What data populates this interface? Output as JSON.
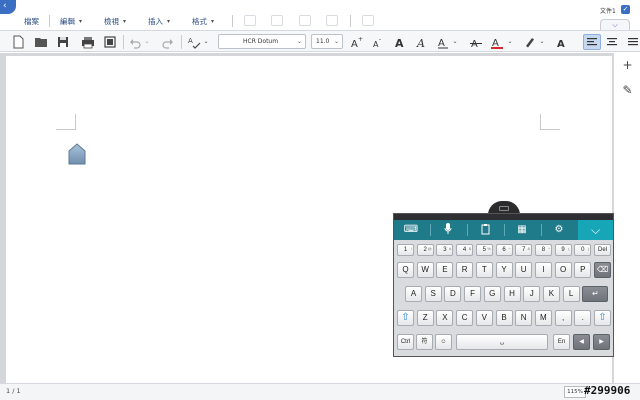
{
  "app": {
    "corner_glyph": "‹",
    "doc_name": "文件1",
    "check_glyph": "✓",
    "fold_glyph": "⌵"
  },
  "menus": [
    {
      "label": "檔案"
    },
    {
      "label": "編輯"
    },
    {
      "label": "檢視"
    },
    {
      "label": "插入"
    },
    {
      "label": "格式"
    }
  ],
  "menu_caret": "▾",
  "toolbar": {
    "font_name": "HCR Dotum",
    "font_size": "11.0",
    "dropdown_glyph": "⌄",
    "icons": {
      "new": "new-document-icon",
      "open": "folder-open-icon",
      "save": "save-icon",
      "print": "print-icon",
      "layout": "page-layout-icon",
      "undo": "undo-icon",
      "redo": "redo-icon",
      "spell": "spellcheck-icon",
      "grow": "grow-font-icon",
      "shrink": "shrink-font-icon",
      "bold": "bold-icon",
      "italic": "italic-icon",
      "underline": "underline-icon",
      "strike": "strikethrough-icon",
      "color": "font-color-icon",
      "highlight": "highlight-icon",
      "shade": "text-shade-icon",
      "align_left": "align-left-icon",
      "align_center": "align-center-icon",
      "align_justify": "align-justify-icon"
    },
    "accent_color": "#c6d7f0",
    "font_color": "#d62b2b"
  },
  "status": {
    "page": "1 / 1",
    "zoom": "115%",
    "watermark": "#299906"
  },
  "side_panel": {
    "add_glyph": "+",
    "edit_glyph": "✎"
  },
  "keyboard": {
    "toolbar_icons": [
      "keyboard-icon",
      "microphone-icon",
      "clipboard-icon",
      "emoji-table-icon",
      "settings-icon",
      "chevron-down-icon"
    ],
    "toolbar_glyphs": [
      "⌨",
      "🎤",
      "📋",
      "▦",
      "⚙",
      "⌵"
    ],
    "number_row": [
      "1",
      "2",
      "3",
      "4",
      "5",
      "6",
      "7",
      "8",
      "9",
      "0",
      "Del"
    ],
    "number_sups": [
      "!",
      "@",
      "#",
      "$",
      "%",
      "^",
      "&",
      "*",
      "(",
      ")",
      ""
    ],
    "row1": [
      "Q",
      "W",
      "E",
      "R",
      "T",
      "Y",
      "U",
      "I",
      "O",
      "P",
      "⌫"
    ],
    "row2": [
      "A",
      "S",
      "D",
      "F",
      "G",
      "H",
      "J",
      "K",
      "L",
      "↵"
    ],
    "row3": [
      "⇧",
      "Z",
      "X",
      "C",
      "V",
      "B",
      "N",
      "M",
      ",",
      ".",
      "⇧"
    ],
    "row4": [
      "Ctrl",
      "符",
      "☺",
      "␣",
      "En",
      "◀",
      "▶"
    ],
    "bar_color": "#1f7a8a",
    "collapse_color": "#16a6b8"
  }
}
